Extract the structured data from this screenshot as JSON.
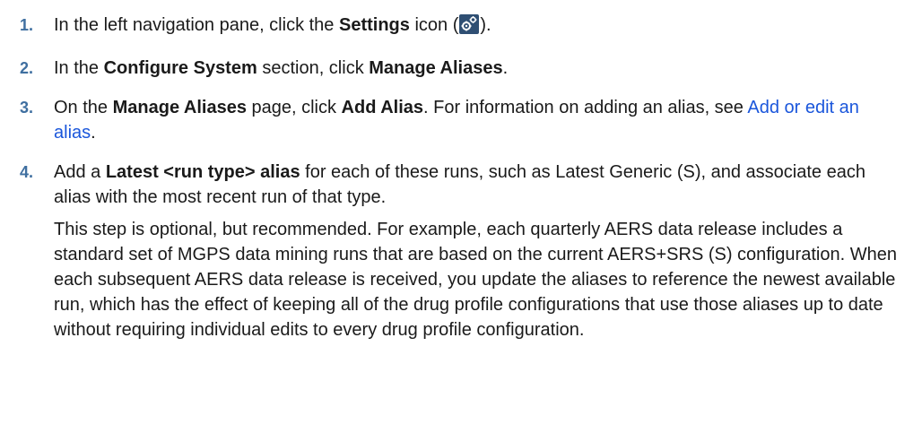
{
  "steps": [
    {
      "number": "1.",
      "parts": {
        "a": "In the left navigation pane, click the ",
        "b": "Settings",
        "c": " icon (",
        "d": ")."
      },
      "icon": "settings-gear-icon"
    },
    {
      "number": "2.",
      "parts": {
        "a": "In the ",
        "b": "Configure System",
        "c": " section, click ",
        "d": "Manage Aliases",
        "e": "."
      }
    },
    {
      "number": "3.",
      "parts": {
        "a": "On the ",
        "b": "Manage Aliases",
        "c": " page, click ",
        "d": "Add Alias",
        "e": ". For information on adding an alias, see ",
        "link": "Add or edit an alias",
        "f": "."
      }
    },
    {
      "number": "4.",
      "parts": {
        "a": "Add a ",
        "b": "Latest <run type> alias",
        "c": " for each of these runs, such as Latest Generic (S), and associate each alias with the most recent run of that type."
      },
      "note": "This step is optional, but recommended. For example, each quarterly AERS data release includes a standard set of MGPS data mining runs that are based on the current AERS+SRS (S) configuration. When each subsequent AERS data release is received, you update the aliases to reference the newest available run, which has the effect of keeping all of the drug profile configurations that use those aliases up to date without requiring individual edits to every drug profile configuration."
    }
  ],
  "colors": {
    "step_number": "#3f6fa0",
    "link": "#1a56db",
    "icon_bg": "#2f4f73"
  }
}
